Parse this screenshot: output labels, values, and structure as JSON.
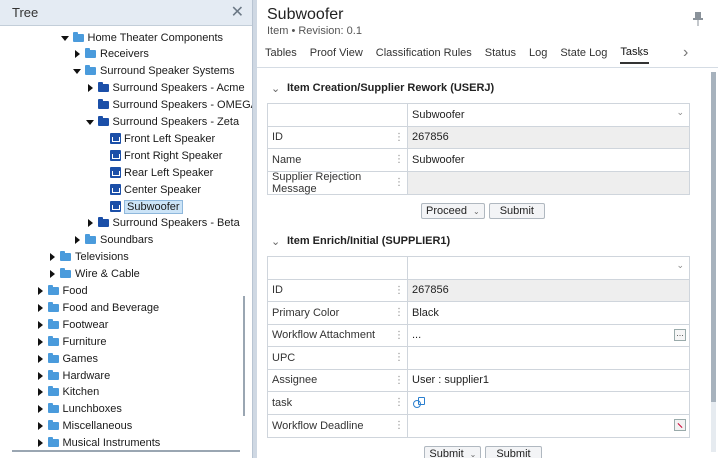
{
  "tree": {
    "title": "Tree",
    "items": [
      {
        "label": "Home Theater Components",
        "level": 5,
        "expander": "down",
        "icon": "folder-light"
      },
      {
        "label": "Receivers",
        "level": 6,
        "expander": "right",
        "icon": "folder-light"
      },
      {
        "label": "Surround Speaker Systems",
        "level": 6,
        "expander": "down",
        "icon": "folder-light"
      },
      {
        "label": "Surround Speakers - Acme",
        "level": 7,
        "expander": "right",
        "icon": "folder-dark"
      },
      {
        "label": "Surround Speakers - OMEGA",
        "level": 7,
        "expander": "none",
        "icon": "folder-dark"
      },
      {
        "label": "Surround Speakers - Zeta",
        "level": 7,
        "expander": "down",
        "icon": "folder-dark"
      },
      {
        "label": "Front Left Speaker",
        "level": 8,
        "expander": "none",
        "icon": "item"
      },
      {
        "label": "Front Right Speaker",
        "level": 8,
        "expander": "none",
        "icon": "item"
      },
      {
        "label": "Rear Left Speaker",
        "level": 8,
        "expander": "none",
        "icon": "item"
      },
      {
        "label": "Center Speaker",
        "level": 8,
        "expander": "none",
        "icon": "item"
      },
      {
        "label": "Subwoofer",
        "level": 8,
        "expander": "none",
        "icon": "item",
        "selected": true
      },
      {
        "label": "Surround Speakers - Beta",
        "level": 7,
        "expander": "right",
        "icon": "folder-dark"
      },
      {
        "label": "Soundbars",
        "level": 6,
        "expander": "right",
        "icon": "folder-light"
      },
      {
        "label": "Televisions",
        "level": 4,
        "expander": "right",
        "icon": "folder-light"
      },
      {
        "label": "Wire & Cable",
        "level": 4,
        "expander": "right",
        "icon": "folder-light"
      },
      {
        "label": "Food",
        "level": 3,
        "expander": "right",
        "icon": "folder-light"
      },
      {
        "label": "Food and Beverage",
        "level": 3,
        "expander": "right",
        "icon": "folder-light"
      },
      {
        "label": "Footwear",
        "level": 3,
        "expander": "right",
        "icon": "folder-light"
      },
      {
        "label": "Furniture",
        "level": 3,
        "expander": "right",
        "icon": "folder-light"
      },
      {
        "label": "Games",
        "level": 3,
        "expander": "right",
        "icon": "folder-light"
      },
      {
        "label": "Hardware",
        "level": 3,
        "expander": "right",
        "icon": "folder-light"
      },
      {
        "label": "Kitchen",
        "level": 3,
        "expander": "right",
        "icon": "folder-light"
      },
      {
        "label": "Lunchboxes",
        "level": 3,
        "expander": "right",
        "icon": "folder-light"
      },
      {
        "label": "Miscellaneous",
        "level": 3,
        "expander": "right",
        "icon": "folder-light"
      },
      {
        "label": "Musical Instruments",
        "level": 3,
        "expander": "right",
        "icon": "folder-light"
      }
    ]
  },
  "panel": {
    "title": "Subwoofer",
    "subtitle": "Item • Revision: 0.1",
    "tabs": [
      "Tables",
      "Proof View",
      "Classification Rules",
      "Status",
      "Log",
      "State Log",
      "Tasks"
    ],
    "active_tab": "Tasks"
  },
  "section1": {
    "title": "Item Creation/Supplier Rework (USERJ)",
    "top_value": "Subwoofer",
    "rows": [
      {
        "label": "ID",
        "value": "267856",
        "gray": true
      },
      {
        "label": "Name",
        "value": "Subwoofer",
        "gray": false
      },
      {
        "label": "Supplier Rejection Message",
        "value": "",
        "gray": true
      }
    ],
    "action_select": "Proceed",
    "submit_label": "Submit"
  },
  "section2": {
    "title": "Item Enrich/Initial (SUPPLIER1)",
    "top_value": "",
    "rows": [
      {
        "label": "ID",
        "value": "267856",
        "gray": true
      },
      {
        "label": "Primary Color",
        "value": "Black",
        "gray": false
      },
      {
        "label": "Workflow Attachment",
        "value": "...",
        "gray": false,
        "extra": "ellipsis"
      },
      {
        "label": "UPC",
        "value": "",
        "gray": false
      },
      {
        "label": "Assignee",
        "value": "User : supplier1",
        "gray": false
      },
      {
        "label": "task",
        "value": "",
        "gray": false,
        "extra": "task"
      },
      {
        "label": "Workflow Deadline",
        "value": "",
        "gray": false,
        "extra": "date"
      }
    ],
    "action_select": "Submit",
    "submit_label": "Submit"
  },
  "colors": {
    "accent": "#1b4fa8",
    "folder_light": "#4a9bdc",
    "selection": "#cce4f7"
  }
}
